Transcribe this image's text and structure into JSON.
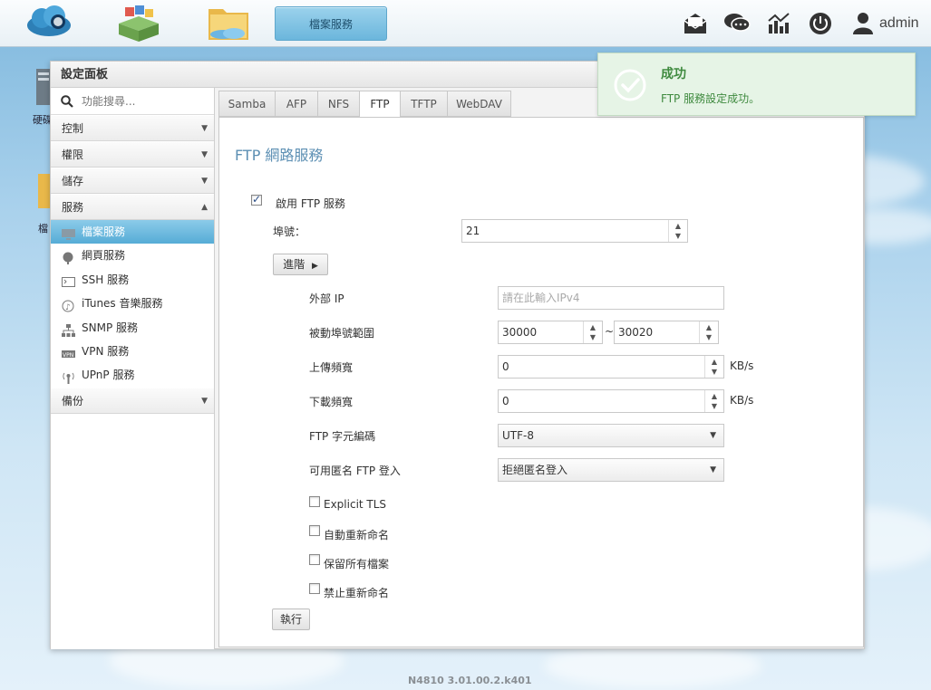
{
  "topbar": {
    "active_app_label": "檔案服務",
    "user_label": "admin",
    "icons": [
      "cloud-logo-icon",
      "apps-box-icon",
      "file-folder-icon",
      "mail-icon",
      "chat-icon",
      "dashboard-icon",
      "power-icon",
      "user-icon"
    ]
  },
  "desktop": {
    "icon1_label": "硬碟",
    "icon2_label": "檔"
  },
  "panel": {
    "title": "設定面板"
  },
  "sidebar": {
    "search_placeholder": "功能搜尋...",
    "groups": [
      {
        "label": "控制",
        "arrow": "▼"
      },
      {
        "label": "權限",
        "arrow": "▼"
      },
      {
        "label": "儲存",
        "arrow": "▼"
      },
      {
        "label": "服務",
        "arrow": "▲"
      },
      {
        "label": "備份",
        "arrow": "▼"
      }
    ],
    "items": [
      {
        "label": "檔案服務",
        "icon": "file-service-icon"
      },
      {
        "label": "網頁服務",
        "icon": "web-globe-icon"
      },
      {
        "label": "SSH 服務",
        "icon": "terminal-icon"
      },
      {
        "label": "iTunes 音樂服務",
        "icon": "music-note-icon"
      },
      {
        "label": "SNMP 服務",
        "icon": "network-tree-icon"
      },
      {
        "label": "VPN 服務",
        "icon": "vpn-icon"
      },
      {
        "label": "UPnP 服務",
        "icon": "upnp-antenna-icon"
      }
    ]
  },
  "tabs": [
    "Samba",
    "AFP",
    "NFS",
    "FTP",
    "TFTP",
    "WebDAV"
  ],
  "active_tab": "FTP",
  "ftp": {
    "section_title": "FTP 網路服務",
    "enable_label": "啟用 FTP 服務",
    "enable_checked": true,
    "port_label": "埠號：",
    "port_value": "21",
    "advanced_label": "進階",
    "external_ip_label": "外部 IP",
    "external_ip_placeholder": "請在此輸入IPv4",
    "passive_label": "被動埠號範圍",
    "passive_from": "30000",
    "passive_sep": "~",
    "passive_to": "30020",
    "upload_label": "上傳頻寬",
    "upload_value": "0",
    "upload_unit": "KB/s",
    "download_label": "下載頻寬",
    "download_value": "0",
    "download_unit": "KB/s",
    "encoding_label": "FTP 字元編碼",
    "encoding_value": "UTF-8",
    "anon_label": "可用匿名 FTP 登入",
    "anon_value": "拒絕匿名登入",
    "explicit_tls_label": "Explicit TLS",
    "auto_rename_label": "自動重新命名",
    "keep_all_label": "保留所有檔案",
    "no_rename_label": "禁止重新命名",
    "apply_label": "執行"
  },
  "toast": {
    "title": "成功",
    "message": "FTP 服務設定成功。"
  },
  "footer": {
    "version": "N4810   3.01.00.2.k401"
  },
  "colors": {
    "accent": "#56acd6",
    "section_title": "#5c8fb3",
    "success": "#3f8a3f",
    "success_bg": "#e6f4e6"
  }
}
